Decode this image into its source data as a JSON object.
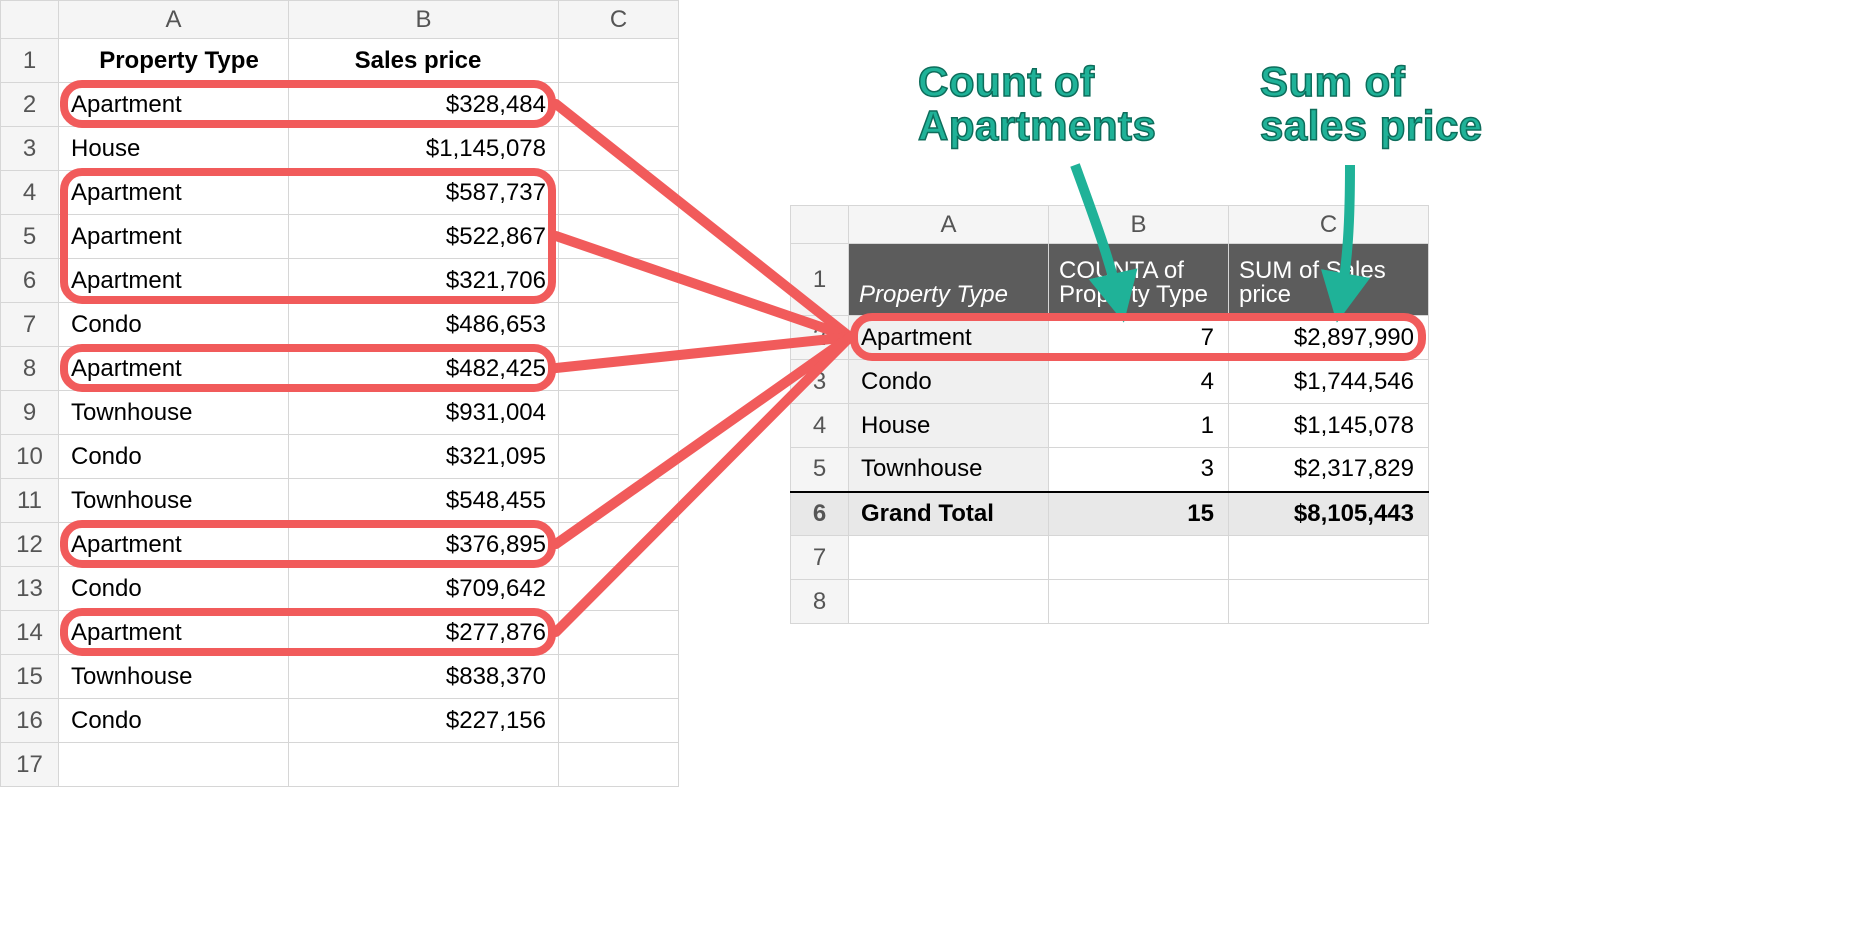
{
  "left": {
    "columns": [
      "A",
      "B",
      "C"
    ],
    "header_row": "1",
    "headers": {
      "A": "Property Type",
      "B": "Sales price"
    },
    "rows": [
      {
        "n": "2",
        "A": "Apartment",
        "B": "$328,484",
        "hl": true
      },
      {
        "n": "3",
        "A": "House",
        "B": "$1,145,078",
        "hl": false
      },
      {
        "n": "4",
        "A": "Apartment",
        "B": "$587,737",
        "hl": true
      },
      {
        "n": "5",
        "A": "Apartment",
        "B": "$522,867",
        "hl": true
      },
      {
        "n": "6",
        "A": "Apartment",
        "B": "$321,706",
        "hl": true
      },
      {
        "n": "7",
        "A": "Condo",
        "B": "$486,653",
        "hl": false
      },
      {
        "n": "8",
        "A": "Apartment",
        "B": "$482,425",
        "hl": true
      },
      {
        "n": "9",
        "A": "Townhouse",
        "B": "$931,004",
        "hl": false
      },
      {
        "n": "10",
        "A": "Condo",
        "B": "$321,095",
        "hl": false
      },
      {
        "n": "11",
        "A": "Townhouse",
        "B": "$548,455",
        "hl": false
      },
      {
        "n": "12",
        "A": "Apartment",
        "B": "$376,895",
        "hl": true
      },
      {
        "n": "13",
        "A": "Condo",
        "B": "$709,642",
        "hl": false
      },
      {
        "n": "14",
        "A": "Apartment",
        "B": "$277,876",
        "hl": true
      },
      {
        "n": "15",
        "A": "Townhouse",
        "B": "$838,370",
        "hl": false
      },
      {
        "n": "16",
        "A": "Condo",
        "B": "$227,156",
        "hl": false
      },
      {
        "n": "17",
        "A": "",
        "B": "",
        "hl": false
      }
    ]
  },
  "right": {
    "columns": [
      "A",
      "B",
      "C"
    ],
    "row_nums": [
      "1",
      "2",
      "3",
      "4",
      "5",
      "6",
      "7",
      "8"
    ],
    "header": {
      "A": "Property Type",
      "B": "COUNTA of Property Type",
      "C": "SUM of Sales price"
    },
    "data": [
      {
        "A": "Apartment",
        "B": "7",
        "C": "$2,897,990",
        "hl": true
      },
      {
        "A": "Condo",
        "B": "4",
        "C": "$1,744,546",
        "hl": false
      },
      {
        "A": "House",
        "B": "1",
        "C": "$1,145,078",
        "hl": false
      },
      {
        "A": "Townhouse",
        "B": "3",
        "C": "$2,317,829",
        "hl": false
      }
    ],
    "grand": {
      "A": "Grand Total",
      "B": "15",
      "C": "$8,105,443"
    }
  },
  "annotations": {
    "count": "Count of\nApartments",
    "sum": "Sum of\nsales price"
  }
}
